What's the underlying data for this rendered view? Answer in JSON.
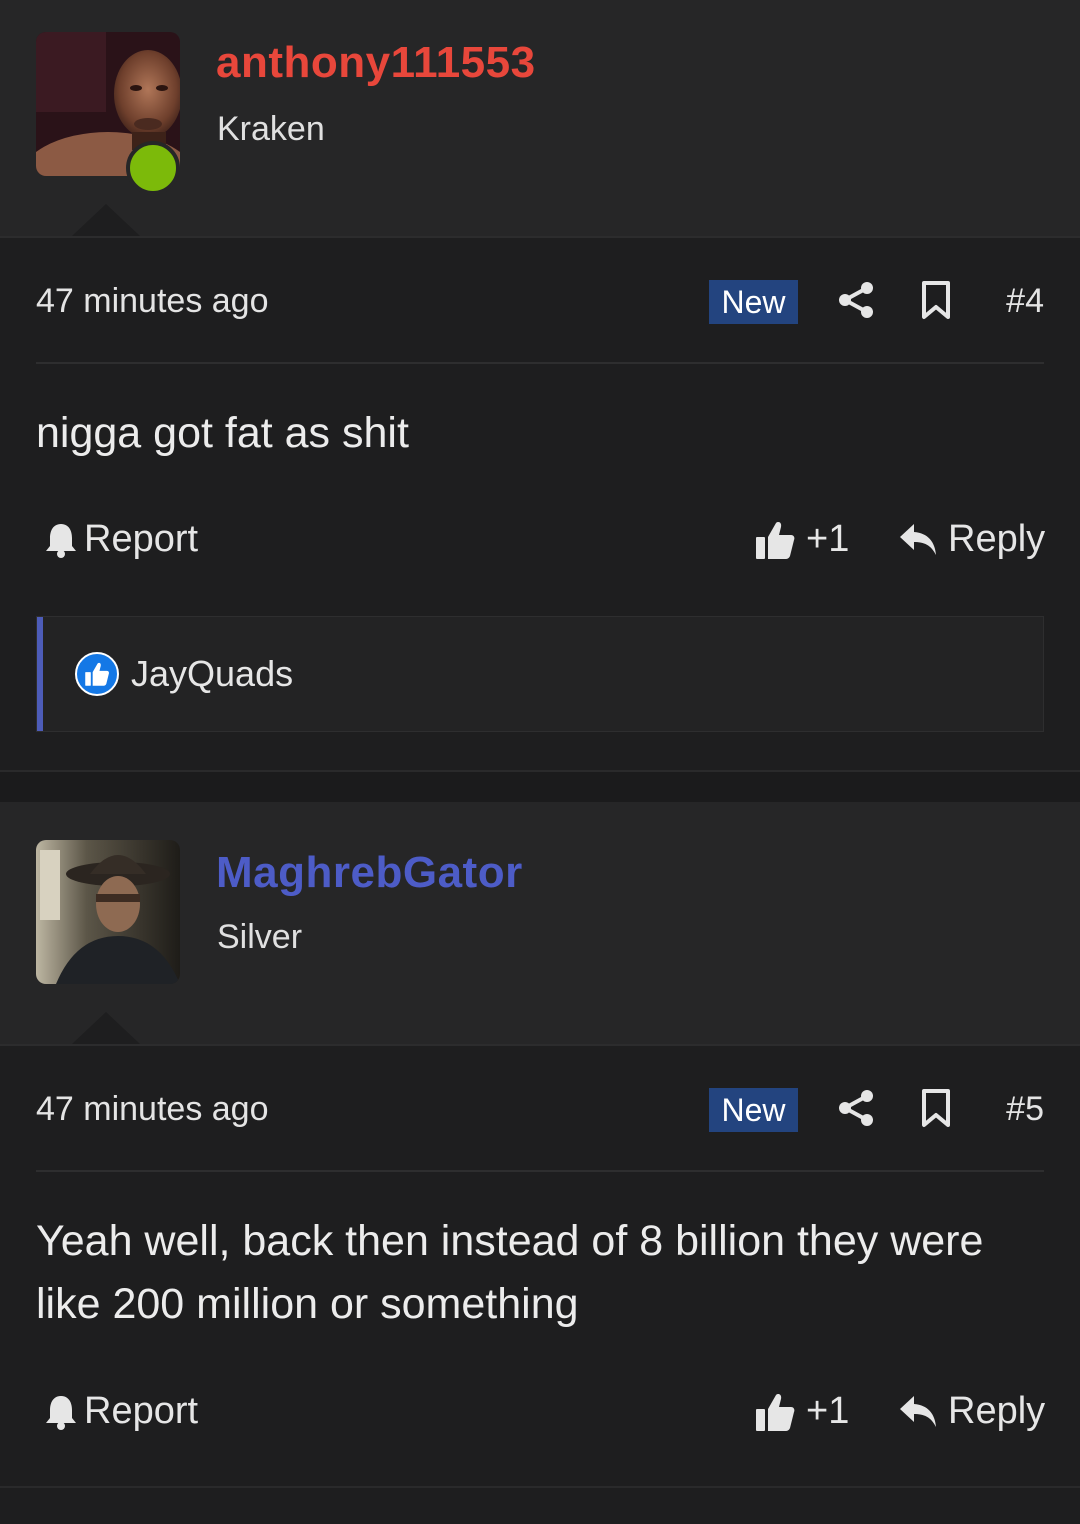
{
  "posts": [
    {
      "username": "anthony111553",
      "username_color": "#e8473b",
      "user_title": "Kraken",
      "online": true,
      "time": "47 minutes ago",
      "badge": "New",
      "number": "#4",
      "message": "nigga got fat as shit",
      "report_label": "Report",
      "like_count": "+1",
      "reply_label": "Reply",
      "reactions": [
        {
          "name": "JayQuads",
          "icon": "thumbs-up-icon"
        }
      ]
    },
    {
      "username": "MaghrebGator",
      "username_color": "#4d5cc7",
      "user_title": "Silver",
      "online": false,
      "time": "47 minutes ago",
      "badge": "New",
      "number": "#5",
      "message": "Yeah well, back then instead of 8 billion they were like 200 million or something",
      "report_label": "Report",
      "like_count": "+1",
      "reply_label": "Reply"
    }
  ],
  "icons": {
    "report": "bell-icon",
    "like": "thumbs-up-icon",
    "reply": "reply-arrow-icon",
    "share": "share-icon",
    "bookmark": "bookmark-icon"
  },
  "colors": {
    "badge_bg": "#23447f",
    "reaction_bar": "#4d5cb8",
    "online_dot": "#7cba0a"
  }
}
